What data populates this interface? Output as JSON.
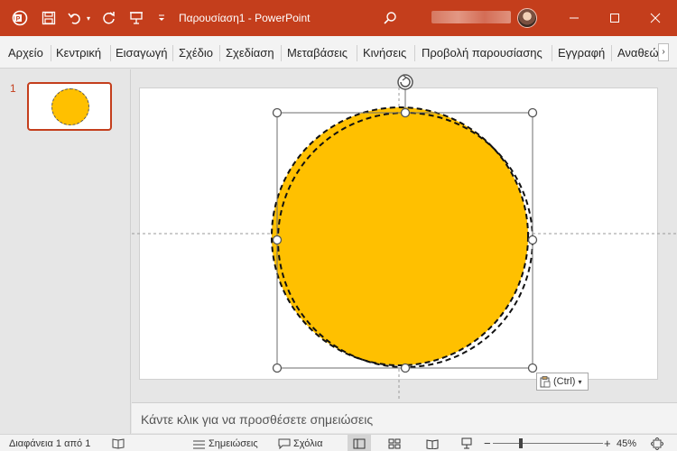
{
  "titlebar": {
    "title": "Παρουσίαση1  -  PowerPoint",
    "icons": [
      "powerpoint-logo",
      "save-icon",
      "undo-icon",
      "undo-dropdown-icon",
      "redo-icon",
      "presentation-icon",
      "customize-toolbar-icon",
      "search-icon",
      "minimize-icon",
      "maximize-icon",
      "close-icon"
    ],
    "accent": "#c43e1c"
  },
  "ribbon": {
    "tabs": [
      "Αρχείο",
      "Κεντρική",
      "Εισαγωγή",
      "Σχέδιο",
      "Σχεδίαση",
      "Μεταβάσεις",
      "Κινήσεις",
      "Προβολή παρουσίασης",
      "Εγγραφή",
      "Αναθεώ"
    ],
    "more": "›"
  },
  "thumbnails": {
    "slide_number": "1"
  },
  "slide": {
    "shape_fill": "#ffc000",
    "paste_options_label": "(Ctrl)"
  },
  "notes": {
    "placeholder": "Κάντε κλικ για να προσθέσετε σημειώσεις"
  },
  "statusbar": {
    "slide_info": "Διαφάνεια 1 από 1",
    "notes_label": "Σημειώσεις",
    "comments_label": "Σχόλια",
    "zoom_minus": "−",
    "zoom_plus": "+",
    "zoom": "45%"
  }
}
